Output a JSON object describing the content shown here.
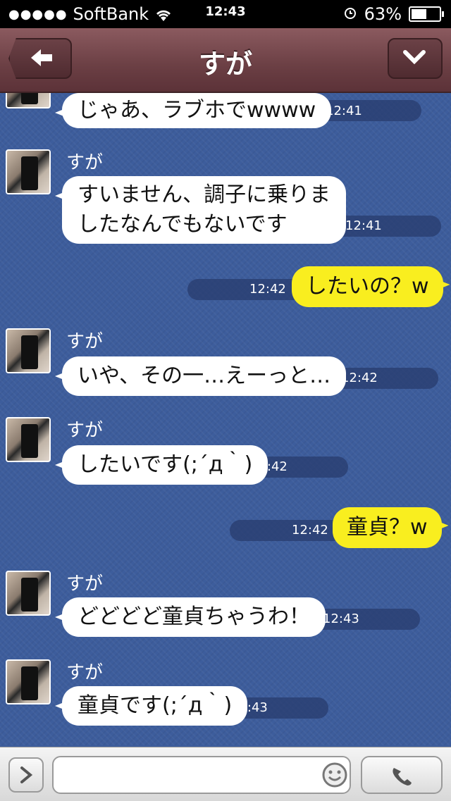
{
  "status_bar": {
    "carrier_dots": "●●●●●",
    "carrier": "SoftBank",
    "time": "12:43",
    "battery": "63%",
    "battery_level": 0.63
  },
  "header": {
    "title": "すが"
  },
  "messages": [
    {
      "direction": "in",
      "sender": "",
      "text": "じゃあ、ラブホでwwww",
      "time": "12:41"
    },
    {
      "direction": "in",
      "sender": "すが",
      "text_lines": [
        "すいません、調子に乗りま",
        "したなんでもないです"
      ],
      "time": "12:41"
    },
    {
      "direction": "out",
      "text": "したいの？w",
      "time": "12:42"
    },
    {
      "direction": "in",
      "sender": "すが",
      "text": "いや、その一…えーっと…",
      "time": "12:42"
    },
    {
      "direction": "in",
      "sender": "すが",
      "text": "したいです(;´д｀)",
      "time": "12:42"
    },
    {
      "direction": "out",
      "text": "童貞？w",
      "time": "12:42"
    },
    {
      "direction": "in",
      "sender": "すが",
      "text": "どどどど童貞ちゃうわ！",
      "time": "12:43"
    },
    {
      "direction": "in",
      "sender": "すが",
      "text": "童貞です(;´д｀)",
      "time": "12:43"
    }
  ],
  "input": {
    "value": "",
    "placeholder": ""
  },
  "icons": {
    "back": "arrow-left-icon",
    "menu": "chevron-down-icon",
    "attach": "chevron-right-icon",
    "emoji": "smiley-icon",
    "call": "phone-icon"
  },
  "colors": {
    "header": "#6b3f44",
    "chat_bg": "#3d5d9c",
    "incoming_bubble": "#ffffff",
    "outgoing_bubble": "#f9ee1f"
  }
}
